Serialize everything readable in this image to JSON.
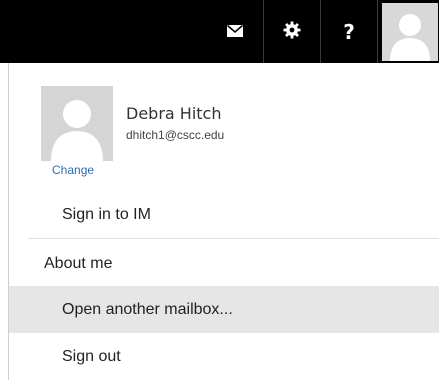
{
  "header": {
    "mail_icon": "mail-icon",
    "settings_icon": "gear-icon",
    "help_label": "?",
    "avatar_icon": "user-avatar-icon"
  },
  "profile": {
    "name": "Debra Hitch",
    "email": "dhitch1@cscc.edu",
    "change_label": "Change",
    "avatar_icon": "user-avatar-icon"
  },
  "menu": {
    "items": [
      {
        "label": "Sign in to IM"
      },
      {
        "label": "About me"
      },
      {
        "label": "Open another mailbox..."
      },
      {
        "label": "Sign out"
      }
    ]
  },
  "colors": {
    "topbar": "#000000",
    "link": "#2b6db5",
    "highlight": "#e6e6e6"
  }
}
